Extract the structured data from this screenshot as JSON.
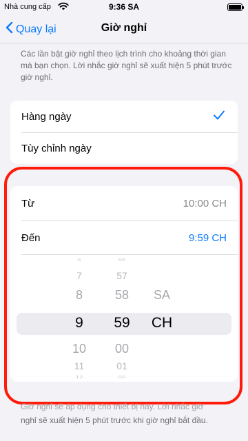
{
  "status_bar": {
    "carrier": "Nhà cung cấp",
    "time": "9:36 SA"
  },
  "nav": {
    "back_label": "Quay lại",
    "title": "Giờ nghỉ"
  },
  "description": "Các lần bật giờ nghỉ theo lịch trình cho khoảng thời gian mà bạn chọn. Lời nhắc giờ nghỉ sẽ xuất hiện 5 phút trước giờ nghỉ.",
  "schedule": {
    "options": [
      {
        "label": "Hàng ngày",
        "selected": true
      },
      {
        "label": "Tùy chỉnh ngày",
        "selected": false
      }
    ]
  },
  "time_range": {
    "from_label": "Từ",
    "from_value": "10:00 CH",
    "to_label": "Đến",
    "to_value": "9:59 CH"
  },
  "picker": {
    "hours": [
      "6",
      "7",
      "8",
      "9",
      "10",
      "11",
      "12"
    ],
    "minutes": [
      "56",
      "57",
      "58",
      "59",
      "00",
      "01",
      "02"
    ],
    "periods": [
      "SA",
      "CH"
    ],
    "selected_hour": "9",
    "selected_minute": "59",
    "selected_period": "CH"
  },
  "footer": {
    "line1": "Giờ nghỉ sẽ áp dụng cho thiết bị này. Lời nhắc giờ",
    "line2": "nghỉ sẽ xuất hiện 5 phút trước khi giờ nghỉ bắt đầu."
  },
  "colors": {
    "accent": "#0a7aff",
    "highlight": "#ff1a0a",
    "background": "#f2f2f7"
  }
}
